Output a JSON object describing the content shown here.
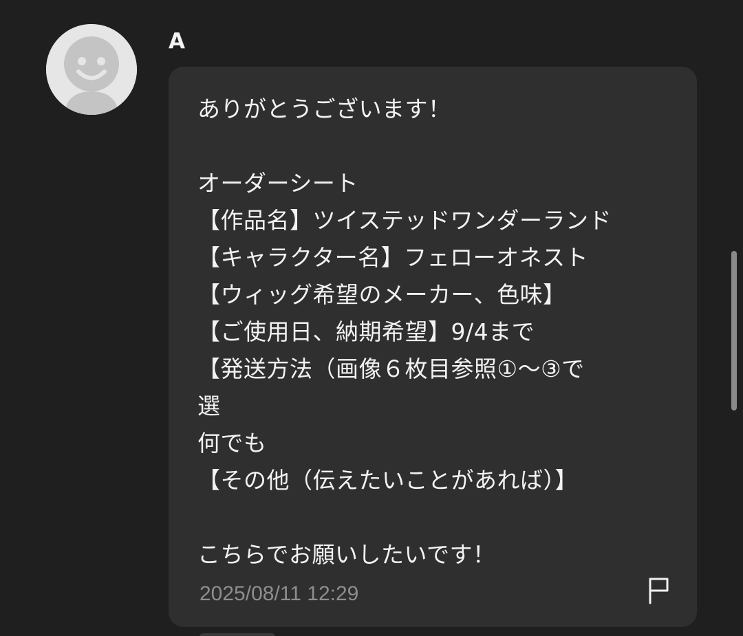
{
  "message": {
    "sender": "A",
    "avatar_icon": "default-user-avatar-icon",
    "lines": [
      "ありがとうございます！",
      "",
      "オーダーシート",
      "【作品名】ツイステッドワンダーランド",
      "【キャラクター名】フェローオネスト",
      "【ウィッグ希望のメーカー、色味】",
      "【ご使用日、納期希望】9/4まで",
      "【発送方法（画像６枚目参照①〜③で",
      "選",
      "何でも",
      "【その他（伝えたいことがあれば）】",
      "",
      "こちらでお願いしたいです！"
    ],
    "timestamp": "2025/08/11 12:29",
    "report_icon": "flag-icon"
  },
  "colors": {
    "background": "#1f1f1f",
    "bubble": "#2f2f2f",
    "text": "#f2f2f2",
    "timestamp": "#8e8e8e"
  }
}
